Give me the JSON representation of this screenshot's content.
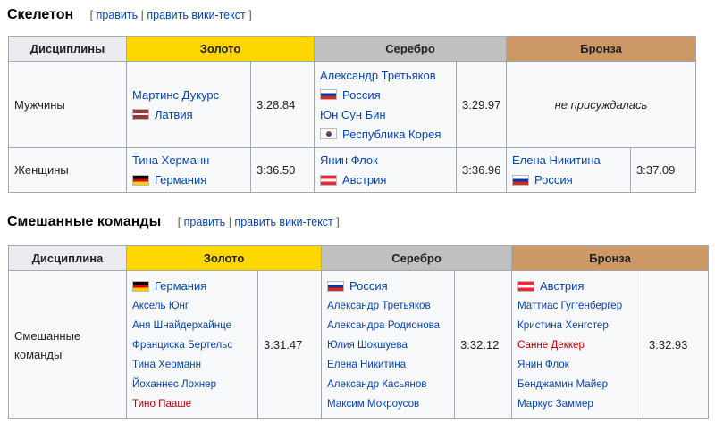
{
  "skeleton": {
    "title": "Скелетон",
    "edit_open": "[",
    "edit_label": "править",
    "edit_sep": "|",
    "edit_source_label": "править вики-текст",
    "edit_close": "]",
    "headers": {
      "discipline": "Дисциплины",
      "gold": "Золото",
      "silver": "Серебро",
      "bronze": "Бронза"
    },
    "men": {
      "label": "Мужчины",
      "gold": {
        "name": "Мартинс Дукурс",
        "country": "Латвия",
        "time": "3:28.84"
      },
      "silver": [
        {
          "name": "Александр Третьяков",
          "country": "Россия"
        },
        {
          "name": "Юн Сун Бин",
          "country": "Республика Корея"
        }
      ],
      "silver_time": "3:29.97",
      "bronze_note": "не присуждалась"
    },
    "women": {
      "label": "Женщины",
      "gold": {
        "name": "Тина Херманн",
        "country": "Германия",
        "time": "3:36.50"
      },
      "silver": {
        "name": "Янин Флок",
        "country": "Австрия",
        "time": "3:36.96"
      },
      "bronze": {
        "name": "Елена Никитина",
        "country": "Россия",
        "time": "3:37.09"
      }
    }
  },
  "mixed": {
    "title": "Смешанные команды",
    "edit_open": "[",
    "edit_label": "править",
    "edit_sep": "|",
    "edit_source_label": "править вики-текст",
    "edit_close": "]",
    "headers": {
      "discipline": "Дисциплина",
      "gold": "Золото",
      "silver": "Серебро",
      "bronze": "Бронза"
    },
    "row_label": "Смешанные команды",
    "gold": {
      "country": "Германия",
      "members": [
        "Аксель Юнг",
        "Аня Шнайдерхайнце",
        "Франциска Бертельс",
        "Тина Херманн",
        "Йоханнес Лохнер",
        "Тино Пааше"
      ],
      "time": "3:31.47"
    },
    "silver": {
      "country": "Россия",
      "members": [
        "Александр Третьяков",
        "Александра Родионова",
        "Юлия Шокшуева",
        "Елена Никитина",
        "Александр Касьянов",
        "Максим Мокроусов"
      ],
      "time": "3:32.12"
    },
    "bronze": {
      "country": "Австрия",
      "members": [
        "Маттиас Гуггенбергер",
        "Кристина Хенгстер",
        "Санне Деккер",
        "Янин Флок",
        "Бенджамин Майер",
        "Маркус Заммер"
      ],
      "time": "3:32.93"
    }
  }
}
